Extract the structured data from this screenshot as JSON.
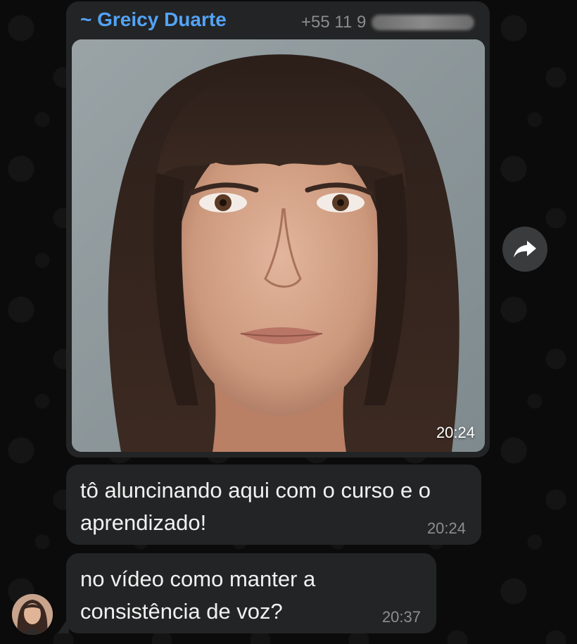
{
  "message_image": {
    "sender_name": "~ Greicy Duarte",
    "sender_phone": "+55 11 9",
    "time": "20:24",
    "photo_icon": "portrait-photo"
  },
  "messages": [
    {
      "text": "tô aluncinando aqui com o curso e o aprendizado!",
      "time": "20:24"
    },
    {
      "text": "no vídeo como manter a consistência de voz?",
      "time": "20:37"
    }
  ],
  "forward_icon": "forward-arrow-icon",
  "avatar_icon": "sender-avatar",
  "colors": {
    "background": "#0b0b0b",
    "bubble": "#232425",
    "sender_name": "#53a3f5",
    "text": "#f1f1f1",
    "timestamp": "#8e8e8e"
  }
}
